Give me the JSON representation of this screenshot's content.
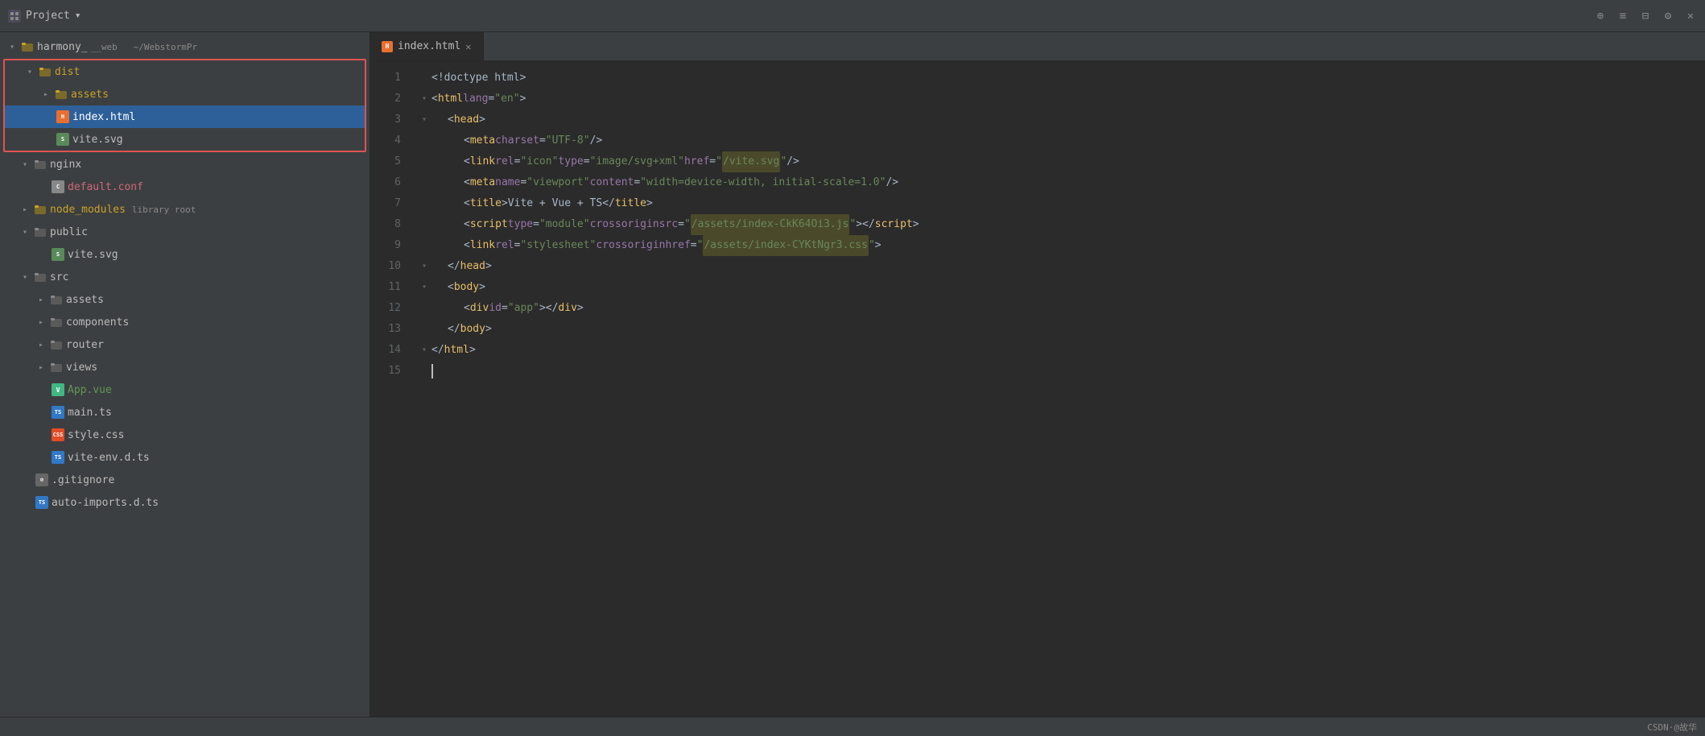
{
  "titleBar": {
    "projectLabel": "Project",
    "dropdown": "▾",
    "icons": {
      "add": "⊕",
      "sort": "≡",
      "collapse": "⊟",
      "settings": "⚙",
      "close": "✕"
    }
  },
  "sidebar": {
    "title": "Project",
    "rootFolder": "harmony___web",
    "rootPath": "~/WebstormPr",
    "tree": [
      {
        "id": "dist",
        "label": "dist",
        "type": "folder",
        "indent": 24,
        "expanded": true,
        "color": "yellow",
        "redBorder": true
      },
      {
        "id": "assets",
        "label": "assets",
        "type": "folder",
        "indent": 48,
        "expanded": false,
        "color": "yellow",
        "redBorder": true
      },
      {
        "id": "index.html",
        "label": "index.html",
        "type": "html",
        "indent": 48,
        "color": "white",
        "selected": true,
        "redBorder": true
      },
      {
        "id": "vite.svg",
        "label": "vite.svg",
        "type": "svg",
        "indent": 48,
        "color": "white",
        "redBorder": true
      },
      {
        "id": "nginx",
        "label": "nginx",
        "type": "folder",
        "indent": 24,
        "expanded": true,
        "color": "white"
      },
      {
        "id": "default.conf",
        "label": "default.conf",
        "type": "conf",
        "indent": 48,
        "color": "red"
      },
      {
        "id": "node_modules",
        "label": "node_modules",
        "type": "folder",
        "indent": 24,
        "expanded": false,
        "color": "yellow",
        "badge": "library root"
      },
      {
        "id": "public",
        "label": "public",
        "type": "folder",
        "indent": 24,
        "expanded": true,
        "color": "white"
      },
      {
        "id": "public-vite.svg",
        "label": "vite.svg",
        "type": "svg",
        "indent": 48,
        "color": "white"
      },
      {
        "id": "src",
        "label": "src",
        "type": "folder",
        "indent": 24,
        "expanded": true,
        "color": "white"
      },
      {
        "id": "src-assets",
        "label": "assets",
        "type": "folder",
        "indent": 48,
        "expanded": false,
        "color": "white"
      },
      {
        "id": "components",
        "label": "components",
        "type": "folder",
        "indent": 48,
        "expanded": false,
        "color": "white"
      },
      {
        "id": "router",
        "label": "router",
        "type": "folder",
        "indent": 48,
        "expanded": false,
        "color": "white"
      },
      {
        "id": "views",
        "label": "views",
        "type": "folder",
        "indent": 48,
        "expanded": false,
        "color": "white"
      },
      {
        "id": "App.vue",
        "label": "App.vue",
        "type": "vue",
        "indent": 48,
        "color": "green"
      },
      {
        "id": "main.ts",
        "label": "main.ts",
        "type": "ts",
        "indent": 48,
        "color": "white"
      },
      {
        "id": "style.css",
        "label": "style.css",
        "type": "css",
        "indent": 48,
        "color": "white"
      },
      {
        "id": "vite-env.d.ts",
        "label": "vite-env.d.ts",
        "type": "ts",
        "indent": 48,
        "color": "white"
      },
      {
        "id": ".gitignore",
        "label": ".gitignore",
        "type": "git",
        "indent": 24,
        "color": "white"
      },
      {
        "id": "auto-imports.d.ts",
        "label": "auto-imports.d.ts",
        "type": "ts",
        "indent": 24,
        "color": "white"
      }
    ]
  },
  "tabs": [
    {
      "id": "index.html",
      "label": "index.html",
      "active": true,
      "type": "html"
    }
  ],
  "editor": {
    "filename": "index.html",
    "lines": [
      {
        "num": 1,
        "indent": 0,
        "foldable": false,
        "content": "doctype_html"
      },
      {
        "num": 2,
        "indent": 0,
        "foldable": true,
        "content": "html_lang"
      },
      {
        "num": 3,
        "indent": 1,
        "foldable": true,
        "content": "head_open"
      },
      {
        "num": 4,
        "indent": 2,
        "foldable": false,
        "content": "meta_charset"
      },
      {
        "num": 5,
        "indent": 2,
        "foldable": false,
        "content": "link_icon"
      },
      {
        "num": 6,
        "indent": 2,
        "foldable": false,
        "content": "meta_viewport"
      },
      {
        "num": 7,
        "indent": 2,
        "foldable": false,
        "content": "title"
      },
      {
        "num": 8,
        "indent": 2,
        "foldable": false,
        "content": "script_module"
      },
      {
        "num": 9,
        "indent": 2,
        "foldable": false,
        "content": "link_stylesheet"
      },
      {
        "num": 10,
        "indent": 1,
        "foldable": false,
        "content": "head_close"
      },
      {
        "num": 11,
        "indent": 1,
        "foldable": true,
        "content": "body_open"
      },
      {
        "num": 12,
        "indent": 2,
        "foldable": false,
        "content": "div_app"
      },
      {
        "num": 13,
        "indent": 1,
        "foldable": false,
        "content": "body_close"
      },
      {
        "num": 14,
        "indent": 0,
        "foldable": true,
        "content": "html_close"
      },
      {
        "num": 15,
        "indent": 0,
        "foldable": false,
        "content": "cursor"
      }
    ]
  },
  "statusBar": {
    "text": "CSDN·@故华"
  }
}
